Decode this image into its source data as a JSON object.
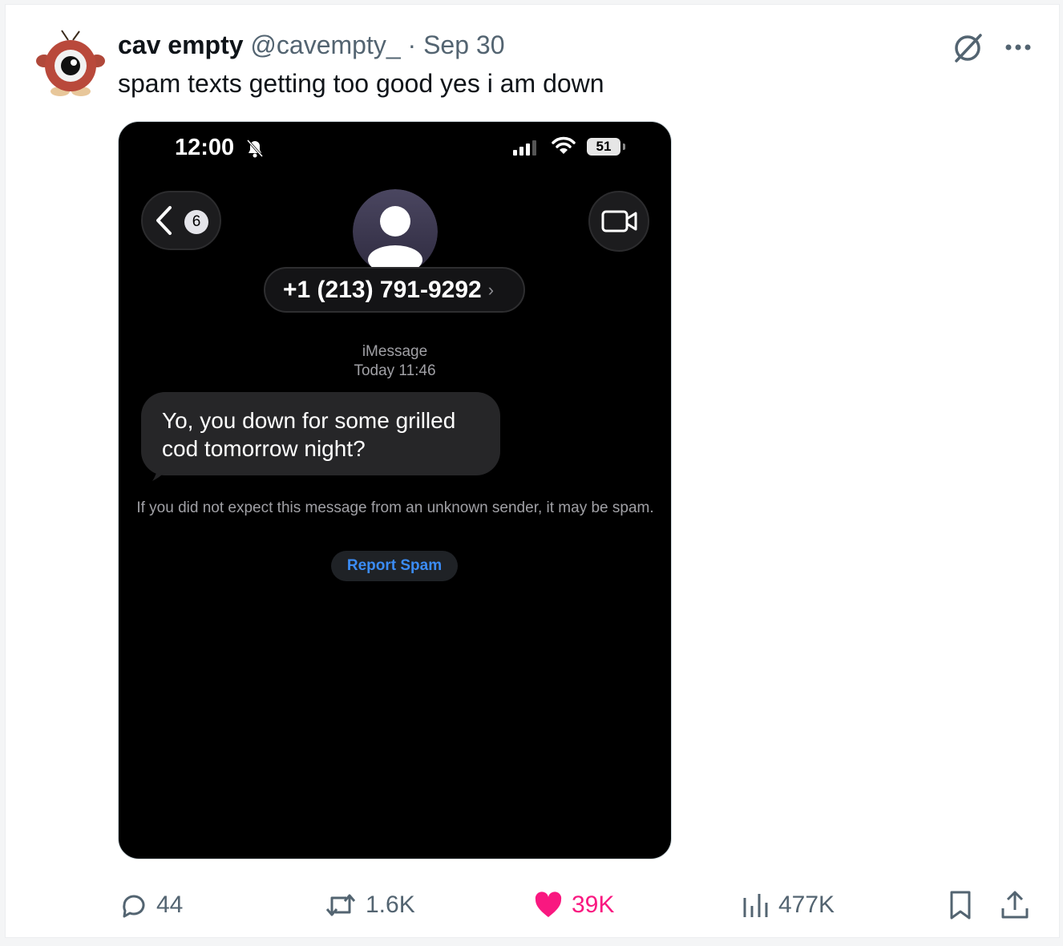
{
  "tweet": {
    "display_name": "cav empty",
    "handle": "@cavempty_",
    "separator": "·",
    "date": "Sep 30",
    "text": "spam texts getting too good yes i am down"
  },
  "screenshot": {
    "status_time": "12:00",
    "battery": "51",
    "back_count": "6",
    "contact": "+1 (213) 791-9292",
    "contact_chevron": "›",
    "service": "iMessage",
    "timestamp": "Today 11:46",
    "message": "Yo, you down for some grilled cod tomorrow night?",
    "spam_warning": "If you did not expect this message from an unknown sender, it may be spam.",
    "report_spam": "Report Spam"
  },
  "actions": {
    "replies": "44",
    "reposts": "1.6K",
    "likes": "39K",
    "views": "477K"
  },
  "icons": [
    "avatar-icon",
    "grok-icon",
    "more-icon",
    "reply-icon",
    "repost-icon",
    "like-icon",
    "views-icon",
    "bookmark-icon",
    "share-icon"
  ],
  "colors": {
    "like": "#f91880",
    "secondary_text": "#536471",
    "link_blue": "#3b8cf5"
  }
}
